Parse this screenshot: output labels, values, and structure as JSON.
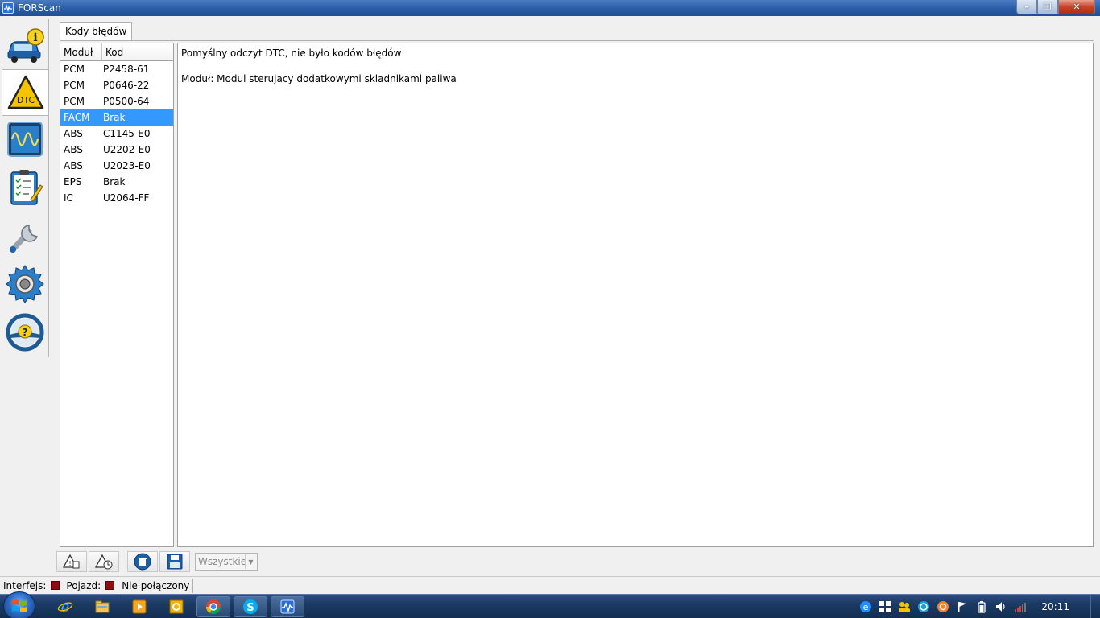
{
  "window": {
    "title": "FORScan"
  },
  "tab": {
    "label": "Kody błędów"
  },
  "list": {
    "columns": [
      "Moduł",
      "Kod"
    ],
    "rows": [
      {
        "module": "PCM",
        "code": "P2458-61"
      },
      {
        "module": "PCM",
        "code": "P0646-22"
      },
      {
        "module": "PCM",
        "code": "P0500-64"
      },
      {
        "module": "FACM",
        "code": "Brak"
      },
      {
        "module": "ABS",
        "code": "C1145-E0"
      },
      {
        "module": "ABS",
        "code": "U2202-E0"
      },
      {
        "module": "ABS",
        "code": "U2023-E0"
      },
      {
        "module": "EPS",
        "code": "Brak"
      },
      {
        "module": "IC",
        "code": "U2064-FF"
      }
    ],
    "selected_index": 3
  },
  "detail": {
    "line1": "Pomyślny odczyt DTC, nie było kodów błędów",
    "line2": "Moduł: Modul sterujacy dodatkowymi skladnikami paliwa"
  },
  "toolbar": {
    "filter": {
      "value": "Wszystkie"
    }
  },
  "statusbar": {
    "interface_label": "Interfejs:",
    "vehicle_label": "Pojazd:",
    "status_text": "Nie połączony",
    "led_color": "#8b0e0e"
  },
  "nav": {
    "items": [
      "vehicle-info-icon",
      "dtc-icon",
      "oscilloscope-icon",
      "checklist-icon",
      "wrench-icon",
      "gear-icon",
      "help-steering-wheel-icon"
    ],
    "active_index": 1
  },
  "taskbar": {
    "apps": [
      "internet-explorer-icon",
      "file-explorer-icon",
      "media-player-icon",
      "outlook-icon",
      "chrome-icon",
      "skype-icon",
      "forscan-icon"
    ],
    "clock": "20:11"
  }
}
